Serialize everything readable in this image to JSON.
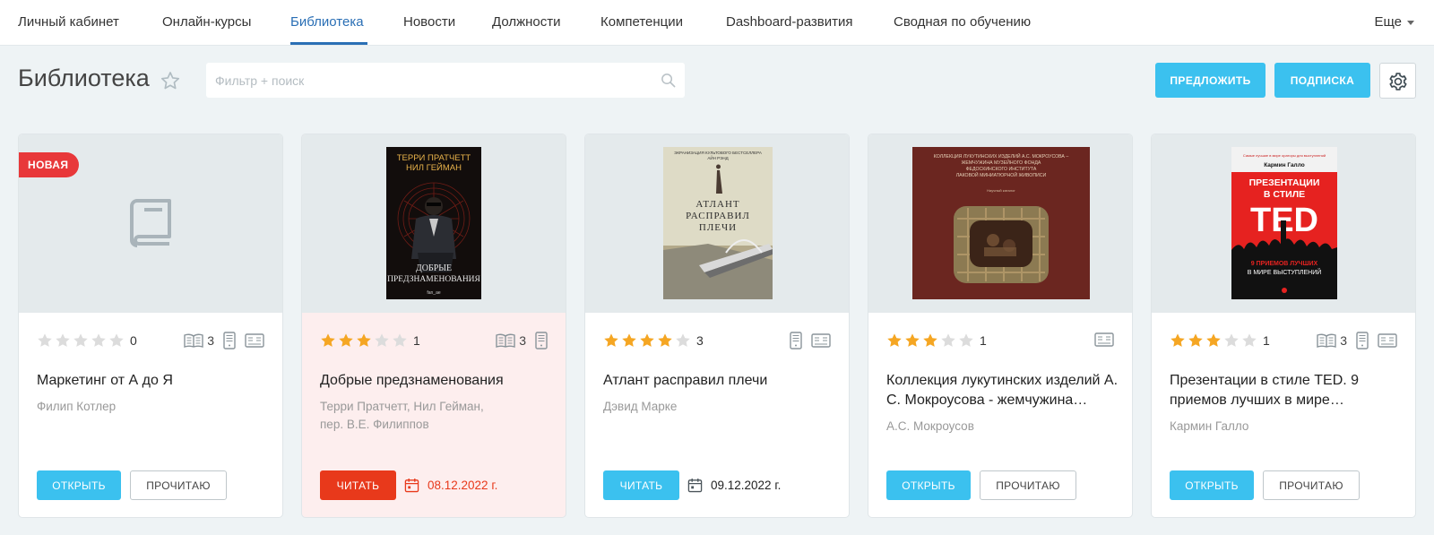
{
  "nav": {
    "items": [
      {
        "label": "Личный кабинет",
        "active": false
      },
      {
        "label": "Онлайн-курсы",
        "active": false
      },
      {
        "label": "Библиотека",
        "active": true
      },
      {
        "label": "Новости",
        "active": false
      },
      {
        "label": "Должности",
        "active": false
      },
      {
        "label": "Компетенции",
        "active": false
      },
      {
        "label": "Dashboard-развития",
        "active": false
      },
      {
        "label": "Сводная по обучению",
        "active": false
      }
    ],
    "more": "Еще"
  },
  "header": {
    "title": "Библиотека",
    "search_placeholder": "Фильтр + поиск",
    "suggest_label": "ПРЕДЛОЖИТЬ",
    "subscribe_label": "ПОДПИСКА"
  },
  "colors": {
    "accent": "#3bc1ef",
    "nav_active": "#2a6fb5",
    "danger": "#e8391b",
    "star_on": "#f5a623",
    "star_off": "#dcdcdc"
  },
  "cards": [
    {
      "badge": "НОВАЯ",
      "rating": 0,
      "rating_count": "0",
      "pages": "3",
      "title": "Маркетинг от А до Я",
      "author": "Филип Котлер",
      "open_label": "ОТКРЫТЬ",
      "read_later_label": "ПРОЧИТАЮ"
    },
    {
      "cover": {
        "top": "ТЕРРИ ПРАТЧЕТТ\nНИЛ ГЕЙМАН",
        "title": "ДОБРЫЕ\nПРЕДЗНАМЕНОВАНИЯ",
        "publisher": "fan_ae"
      },
      "rating": 3,
      "rating_count": "1",
      "pages": "3",
      "title": "Добрые предзнаменования",
      "author": "Терри Пратчетт, Нил Гейман, пер. В.Е. Филиппов",
      "read_label": "ЧИТАТЬ",
      "date": "08.12.2022 г."
    },
    {
      "cover": {
        "top": "ЭКРАНИЗАЦИЯ КУЛЬТОВОГО БЕСТСЕЛЛЕРА\nАЙН РЭНД",
        "title": "АТЛАНТ\nРАСПРАВИЛ\nПЛЕЧИ"
      },
      "rating": 4,
      "rating_count": "3",
      "title": "Атлант расправил плечи",
      "author": "Дэвид Марке",
      "read_label": "ЧИТАТЬ",
      "date": "09.12.2022 г."
    },
    {
      "cover": {
        "top": "КОЛЛЕКЦИЯ ЛУКУТИНСКИХ ИЗДЕЛИЙ А.С. МОКРОУСОВА –\nЖЕМЧУЖИНА МУЗЕЙНОГО ФОНДА\nФЕДОСКИНСКОГО ИНСТИТУТА\nЛАКОВОЙ МИНИАТЮРНОЙ ЖИВОПИСИ",
        "sub": "Научный каталог"
      },
      "rating": 3,
      "rating_count": "1",
      "title": "Коллекция лукутинских изделий А. С. Мокроусова - жемчужина…",
      "author": "А.С. Мокроусов",
      "open_label": "ОТКРЫТЬ",
      "read_later_label": "ПРОЧИТАЮ"
    },
    {
      "cover": {
        "author": "Кармин Галло",
        "title_top": "ПРЕЗЕНТАЦИИ\nВ СТИЛЕ",
        "title_big": "TED",
        "subtitle": "9 ПРИЕМОВ ЛУЧШИХ\nВ МИРЕ ВЫСТУПЛЕНИЙ"
      },
      "rating": 3,
      "rating_count": "1",
      "pages": "3",
      "title": "Презентации в стиле TED. 9 приемов лучших в мире…",
      "author": "Кармин Галло",
      "open_label": "ОТКРЫТЬ",
      "read_later_label": "ПРОЧИТАЮ"
    }
  ]
}
